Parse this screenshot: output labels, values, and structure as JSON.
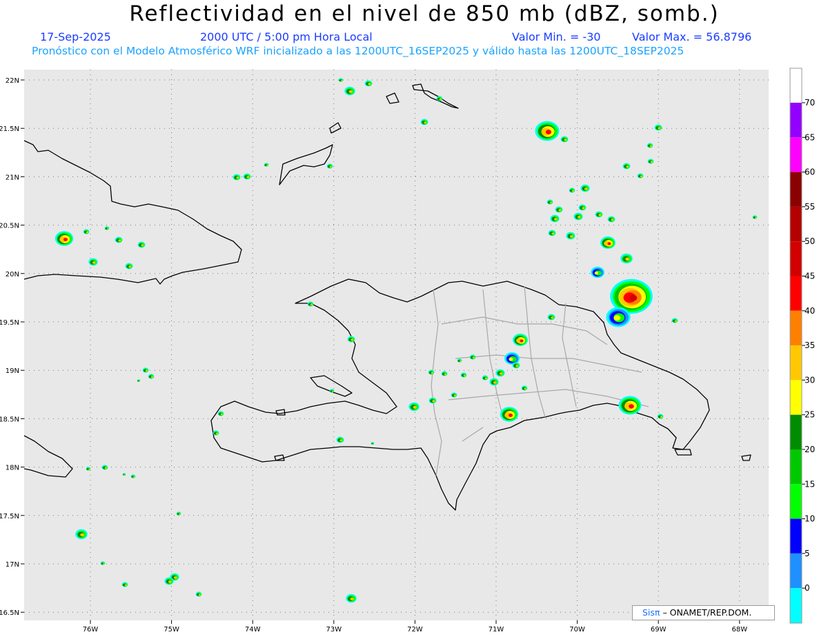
{
  "title": "Reflectividad en el nivel de 850 mb (dBZ, somb.)",
  "date": "17-Sep-2025",
  "time": "2000 UTC / 5:00 pm Hora Local",
  "min_label": "Valor Min. = -30",
  "max_label": "Valor Max. = 56.8796",
  "forecast_info": "Pronóstico con el Modelo Atmosférico WRF inicializado a las 1200UTC_16SEP2025 y válido hasta las  1200UTC_18SEP2025",
  "credit": {
    "brand": "Sisπ",
    "rest": "– ONAMET/REP.DOM."
  },
  "lat_labels": [
    "22N",
    "21.5N",
    "21N",
    "20.5N",
    "20N",
    "19.5N",
    "19N",
    "18.5N",
    "18N",
    "17.5N",
    "17N",
    "16.5N"
  ],
  "lon_labels": [
    "76W",
    "75W",
    "74W",
    "73W",
    "72W",
    "71W",
    "70W",
    "69W",
    "68W"
  ],
  "colorbar": {
    "labels": [
      "0",
      "5",
      "10",
      "15",
      "20",
      "25",
      "30",
      "35",
      "40",
      "45",
      "50",
      "55",
      "60",
      "65",
      "70"
    ],
    "colors": [
      "#00ffff",
      "#1e90ff",
      "#0000ff",
      "#00ff00",
      "#00c800",
      "#008c00",
      "#ffff00",
      "#ffc800",
      "#ff8000",
      "#ff0000",
      "#d20000",
      "#b40000",
      "#8b0000",
      "#ff00ff",
      "#9400ff"
    ]
  },
  "colors": {
    "land_outline": "#000000",
    "province_lines": "#a8a8a8",
    "background": "#e8e8e8"
  }
}
